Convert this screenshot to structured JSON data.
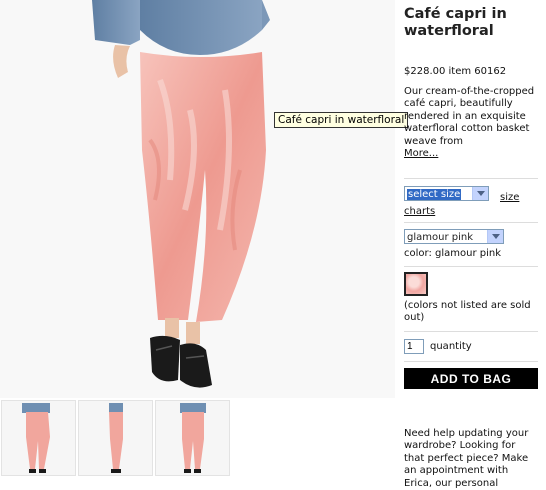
{
  "product": {
    "title": "Café capri in waterfloral",
    "price_line": "$228.00 item 60162",
    "description": "Our cream-of-the-cropped café capri, beautifully rendered in an exquisite waterfloral cotton basket weave from",
    "more_label": "More...",
    "image_tooltip": "Café capri in waterfloral"
  },
  "size": {
    "selected": "select size",
    "charts_link": "size charts"
  },
  "color": {
    "selected": "glamour pink",
    "label": "color: glamour pink",
    "swatch_color": "#f3aaa4",
    "note": "(colors not listed are sold out)"
  },
  "quantity": {
    "value": "1",
    "label": "quantity"
  },
  "add_to_bag_label": "ADD TO BAG",
  "help_text": "Need help updating your wardrobe? Looking for that perfect piece? Make an appointment with Erica, our personal",
  "colors": {
    "pants_pink": "#f2a59c",
    "denim_shirt": "#6f8fb2",
    "shoe_black": "#1a1a1a",
    "button_black": "#000000"
  }
}
